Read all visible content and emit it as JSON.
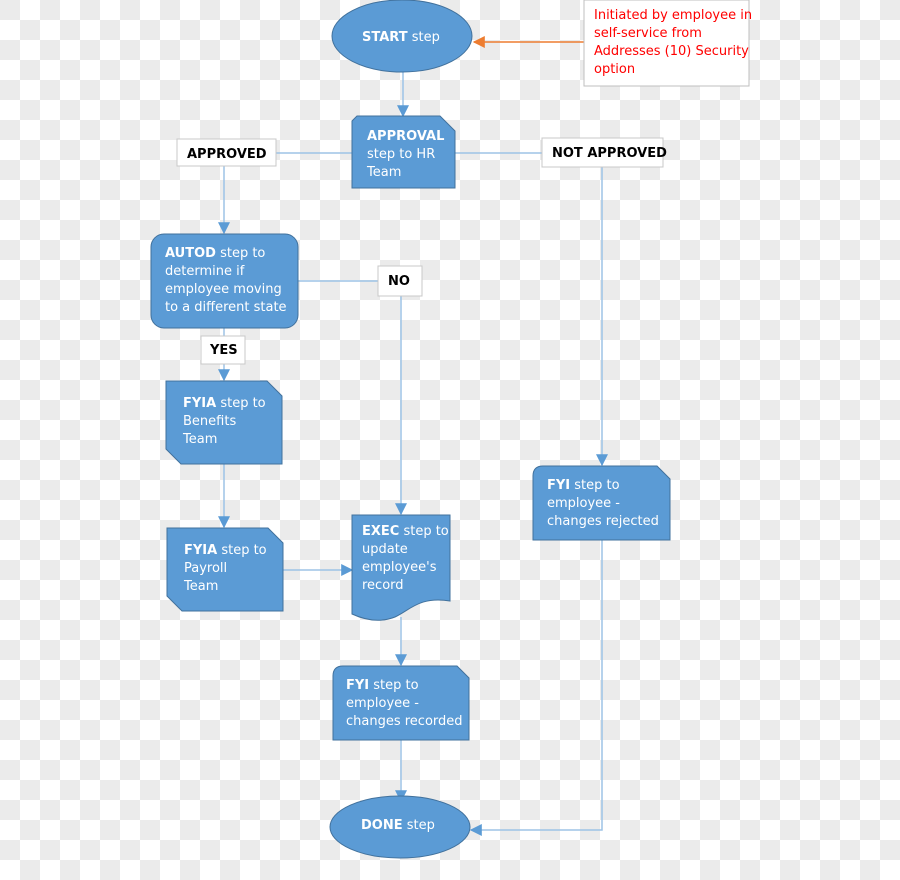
{
  "diagram": {
    "type": "flowchart",
    "colors": {
      "step_fill": "#5b9bd5",
      "step_stroke": "#41719c",
      "connector": "#9dc3e6",
      "note_arrow": "#ed7d31",
      "note_text": "#ff0000"
    },
    "note": {
      "lines": [
        "Initiated by employee in",
        "self-service from",
        "Addresses (10) Security",
        "option"
      ]
    },
    "start": {
      "bold": "START",
      "rest": " step"
    },
    "approval": {
      "lines": [
        {
          "bold": "APPROVAL",
          "rest": ""
        },
        {
          "bold": "",
          "rest": "step to HR"
        },
        {
          "bold": "",
          "rest": "Team"
        }
      ]
    },
    "labels": {
      "approved": "APPROVED",
      "not_approved": "NOT APPROVED",
      "no": "NO",
      "yes": "YES"
    },
    "autod": {
      "lines": [
        {
          "bold": "AUTOD",
          "rest": " step to"
        },
        {
          "bold": "",
          "rest": "determine if"
        },
        {
          "bold": "",
          "rest": "employee moving"
        },
        {
          "bold": "",
          "rest": "to a different state"
        }
      ]
    },
    "fyia_benefits": {
      "lines": [
        {
          "bold": "FYIA",
          "rest": " step to"
        },
        {
          "bold": "",
          "rest": "Benefits"
        },
        {
          "bold": "",
          "rest": "Team"
        }
      ]
    },
    "fyia_payroll": {
      "lines": [
        {
          "bold": "FYIA",
          "rest": " step to"
        },
        {
          "bold": "",
          "rest": "Payroll"
        },
        {
          "bold": "",
          "rest": "Team"
        }
      ]
    },
    "exec": {
      "lines": [
        {
          "bold": "EXEC",
          "rest": " step to"
        },
        {
          "bold": "",
          "rest": "update"
        },
        {
          "bold": "",
          "rest": "employee's"
        },
        {
          "bold": "",
          "rest": "record"
        }
      ]
    },
    "fyi_rejected": {
      "lines": [
        {
          "bold": "FYI",
          "rest": " step to"
        },
        {
          "bold": "",
          "rest": "employee -"
        },
        {
          "bold": "",
          "rest": "changes rejected"
        }
      ]
    },
    "fyi_recorded": {
      "lines": [
        {
          "bold": "FYI",
          "rest": " step to"
        },
        {
          "bold": "",
          "rest": "employee -"
        },
        {
          "bold": "",
          "rest": "changes recorded"
        }
      ]
    },
    "done": {
      "bold": "DONE",
      "rest": " step"
    }
  }
}
